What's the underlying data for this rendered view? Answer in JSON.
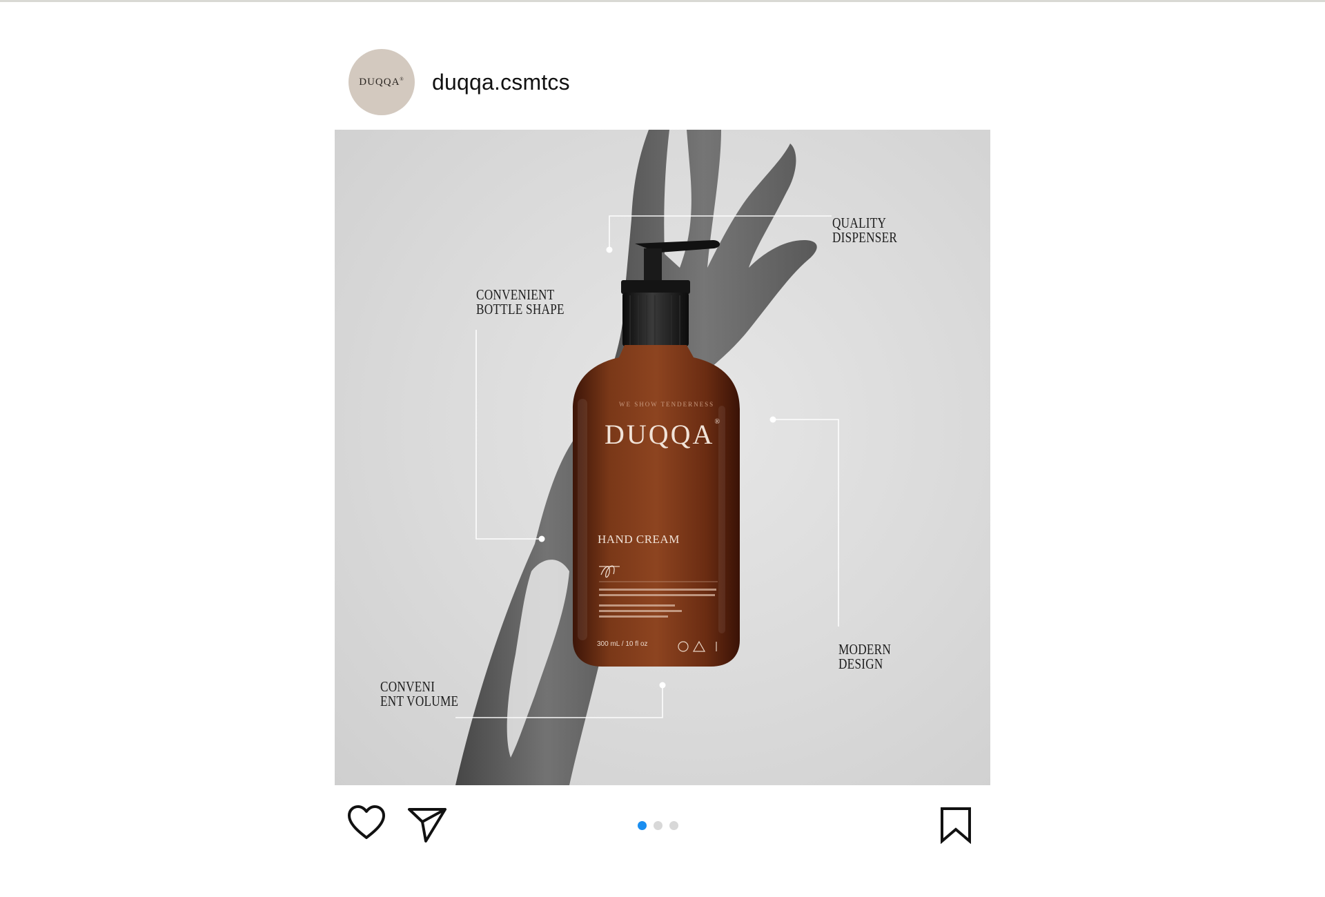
{
  "post": {
    "username": "duqqa.csmtcs",
    "avatar_text": "DUQQA",
    "avatar_mark": "®"
  },
  "image": {
    "callouts": {
      "quality_dispenser": [
        "QUALITY",
        "DISPENSER"
      ],
      "convenient_shape": [
        "CONVENIENT",
        "BOTTLE SHAPE"
      ],
      "modern_design": [
        "MODERN",
        "DESIGN"
      ],
      "convenient_volume": [
        "CONVENI",
        "ENT VOLUME"
      ]
    },
    "bottle": {
      "brand": "DUQQA",
      "brand_mark": "®",
      "tagline": "WE SHOW TENDERNESS",
      "product": "HAND CREAM",
      "volume": "300 mL / 10 fl oz"
    }
  },
  "carousel": {
    "total": 3,
    "active_index": 0
  },
  "icons": {
    "like": "heart-icon",
    "share": "send-icon",
    "save": "bookmark-icon"
  },
  "colors": {
    "accent": "#1a8ef0",
    "avatar_bg": "#d3c9bf",
    "bottle_amber": "#6e3217"
  }
}
